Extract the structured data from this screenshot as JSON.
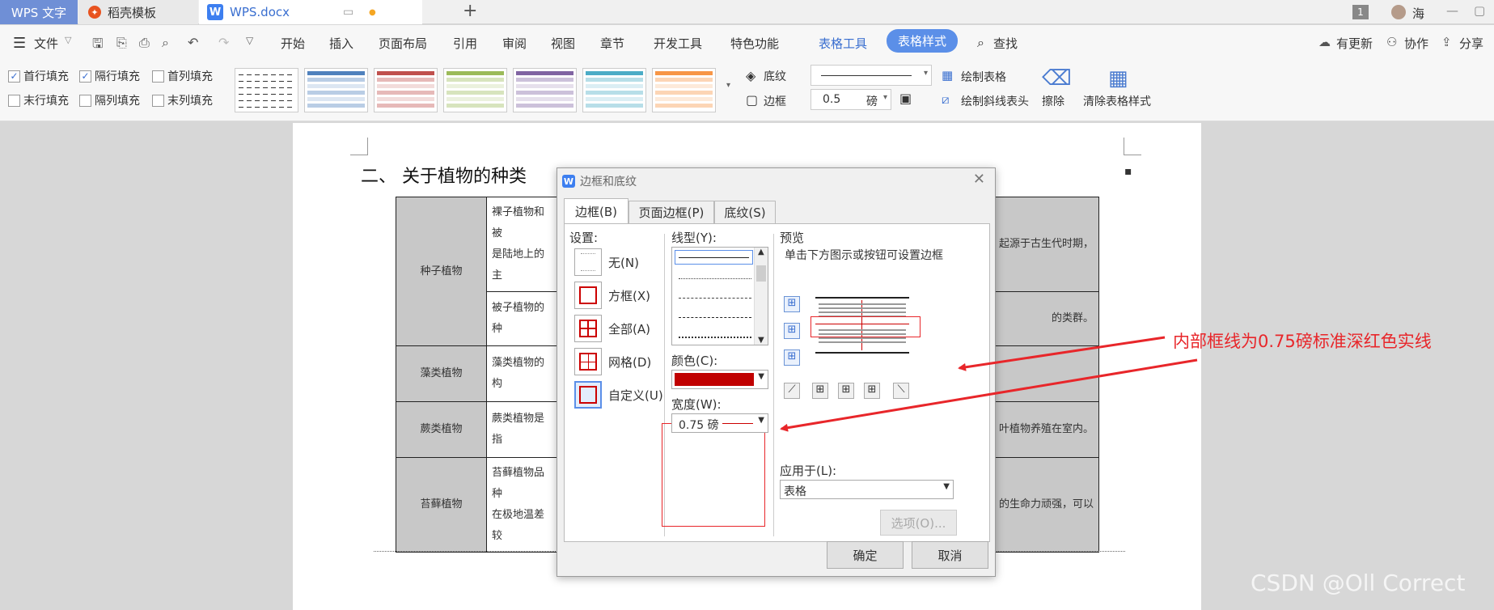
{
  "titlebar": {
    "tabs": [
      {
        "label": "WPS 文字"
      },
      {
        "label": "稻壳模板"
      },
      {
        "label": "WPS.docx"
      }
    ],
    "new_tab": "+",
    "badge": "1",
    "user_name": "海"
  },
  "menubar": {
    "file": "文件",
    "tabs": [
      "开始",
      "插入",
      "页面布局",
      "引用",
      "审阅",
      "视图",
      "章节",
      "开发工具",
      "特色功能",
      "表格工具",
      "表格样式"
    ],
    "search": "查找",
    "right": [
      "有更新",
      "协作",
      "分享"
    ]
  },
  "ribbon": {
    "checkboxes": [
      {
        "label": "首行填充",
        "checked": true
      },
      {
        "label": "隔行填充",
        "checked": true
      },
      {
        "label": "首列填充",
        "checked": false
      },
      {
        "label": "末行填充",
        "checked": false
      },
      {
        "label": "隔列填充",
        "checked": false
      },
      {
        "label": "末列填充",
        "checked": false
      }
    ],
    "style_colors": [
      "#ffffff",
      "#4f81bd",
      "#c0504d",
      "#9bbb59",
      "#8064a2",
      "#4bacc6",
      "#f79646"
    ],
    "shading": "底纹",
    "border": "边框",
    "line_width": "0.5",
    "line_unit": "磅",
    "draw_table": "绘制表格",
    "draw_diagonal": "绘制斜线表头",
    "erase": "擦除",
    "clear_style": "清除表格样式"
  },
  "document": {
    "heading": "二、 关于植物的种类",
    "rows": [
      {
        "name": "种子植物",
        "text": "裸子植物和被",
        "tail": "起源于古生代时期，",
        "text2": "是陆地上的主"
      },
      {
        "name": "",
        "text": "被子植物的种",
        "tail": "的类群。"
      },
      {
        "name": "藻类植物",
        "text": "藻类植物的构",
        "tail": ""
      },
      {
        "name": "蕨类植物",
        "text": "蕨类植物是指",
        "tail": "叶植物养殖在室内。"
      },
      {
        "name": "苔藓植物",
        "text": "苔藓植物品种",
        "tail": "的生命力顽强，可以",
        "text2": "在极地温差较"
      }
    ]
  },
  "dialog": {
    "title": "边框和底纹",
    "tabs": [
      "边框(B)",
      "页面边框(P)",
      "底纹(S)"
    ],
    "settings_label": "设置:",
    "settings": [
      "无(N)",
      "方框(X)",
      "全部(A)",
      "网格(D)",
      "自定义(U)"
    ],
    "line_style_label": "线型(Y):",
    "color_label": "颜色(C):",
    "color_value": "#c00000",
    "width_label": "宽度(W):",
    "width_value": "0.75 磅",
    "preview_label": "预览",
    "preview_hint": "单击下方图示或按钮可设置边框",
    "apply_label": "应用于(L):",
    "apply_value": "表格",
    "options": "选项(O)...",
    "ok": "确定",
    "cancel": "取消"
  },
  "annotation": {
    "text": "内部框线为0.75磅标准深红色实线",
    "color": "#e8262a"
  },
  "watermark": "CSDN @Oll Correct"
}
